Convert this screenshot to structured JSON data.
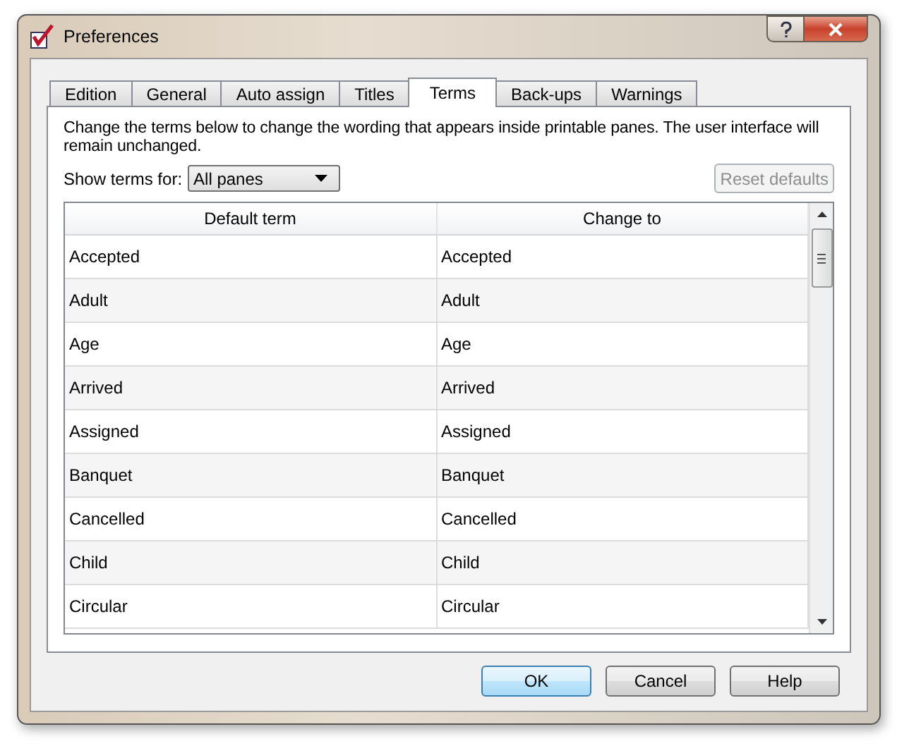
{
  "window": {
    "title": "Preferences"
  },
  "tabs": [
    {
      "label": "Edition",
      "selected": false
    },
    {
      "label": "General",
      "selected": false
    },
    {
      "label": "Auto assign",
      "selected": false
    },
    {
      "label": "Titles",
      "selected": false
    },
    {
      "label": "Terms",
      "selected": true
    },
    {
      "label": "Back-ups",
      "selected": false
    },
    {
      "label": "Warnings",
      "selected": false
    }
  ],
  "description": "Change the terms below to change the wording that appears inside printable panes. The user interface will remain unchanged.",
  "show_terms_for": {
    "label": "Show terms for:",
    "value": "All panes"
  },
  "reset_button": {
    "label": "Reset defaults",
    "disabled": true
  },
  "table": {
    "columns": [
      "Default term",
      "Change to"
    ],
    "rows": [
      [
        "Accepted",
        "Accepted"
      ],
      [
        "Adult",
        "Adult"
      ],
      [
        "Age",
        "Age"
      ],
      [
        "Arrived",
        "Arrived"
      ],
      [
        "Assigned",
        "Assigned"
      ],
      [
        "Banquet",
        "Banquet"
      ],
      [
        "Cancelled",
        "Cancelled"
      ],
      [
        "Child",
        "Child"
      ],
      [
        "Circular",
        "Circular"
      ]
    ]
  },
  "buttons": [
    {
      "label": "OK",
      "default": true
    },
    {
      "label": "Cancel",
      "default": false
    },
    {
      "label": "Help",
      "default": false
    }
  ]
}
